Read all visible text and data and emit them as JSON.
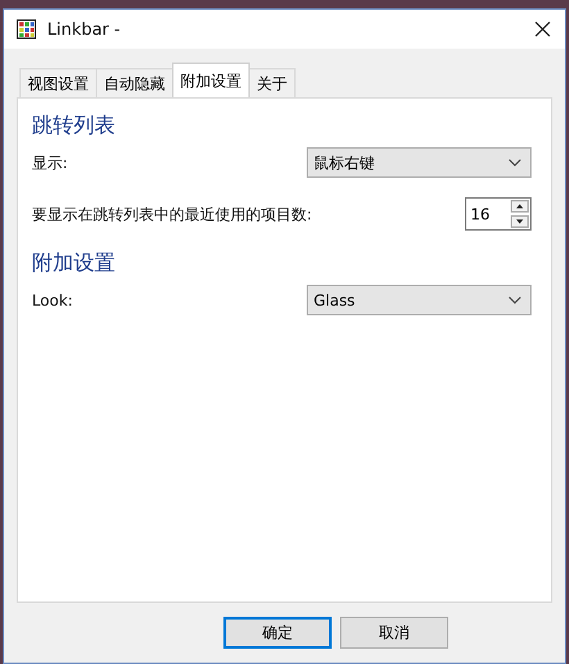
{
  "window": {
    "title": "Linkbar -"
  },
  "tabs": [
    {
      "label": "视图设置",
      "selected": false
    },
    {
      "label": "自动隐藏",
      "selected": false
    },
    {
      "label": "附加设置",
      "selected": true
    },
    {
      "label": "关于",
      "selected": false
    }
  ],
  "sections": [
    {
      "title": "跳转列表",
      "rows": [
        {
          "kind": "dropdown",
          "label": "显示:",
          "value": "鼠标右键"
        },
        {
          "kind": "spinner",
          "label": "要显示在跳转列表中的最近使用的项目数:",
          "value": "16"
        }
      ]
    },
    {
      "title": "附加设置",
      "rows": [
        {
          "kind": "dropdown",
          "label": "Look:",
          "value": "Glass"
        }
      ]
    }
  ],
  "buttons": [
    {
      "label": "确定",
      "default": true
    },
    {
      "label": "取消",
      "default": false
    }
  ]
}
